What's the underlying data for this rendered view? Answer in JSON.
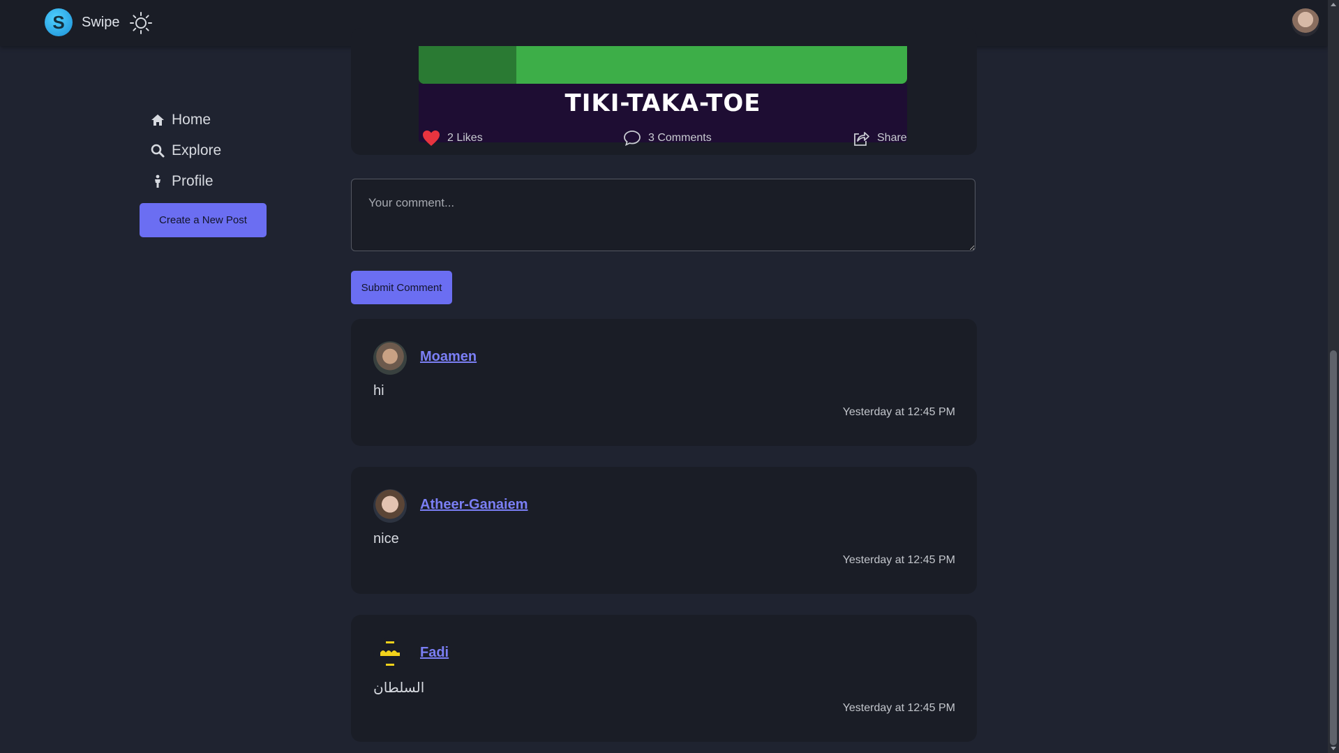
{
  "header": {
    "brand_name": "Swipe",
    "brand_letter": "S"
  },
  "sidebar": {
    "items": [
      {
        "label": "Home",
        "icon": "home-icon"
      },
      {
        "label": "Explore",
        "icon": "search-icon"
      },
      {
        "label": "Profile",
        "icon": "person-icon"
      }
    ],
    "create_label": "Create a New Post"
  },
  "post": {
    "banner_title": "TIKI-TAKA-TOE",
    "likes": "2 Likes",
    "comments": "3 Comments",
    "share": "Share"
  },
  "comment_form": {
    "placeholder": "Your comment...",
    "submit_label": "Submit Comment"
  },
  "comments": [
    {
      "author": "Moamen",
      "text": "hi",
      "time": "Yesterday at 12:45 PM"
    },
    {
      "author": "Atheer-Ganaiem",
      "text": "nice",
      "time": "Yesterday at 12:45 PM"
    },
    {
      "author": "Fadi",
      "text": "السلطان",
      "time": "Yesterday at 12:45 PM"
    }
  ],
  "colors": {
    "accent": "#6b6ef2",
    "link": "#7b7ff5",
    "like": "#e8343f",
    "background": "#1f2330",
    "card": "#1a1d26"
  }
}
